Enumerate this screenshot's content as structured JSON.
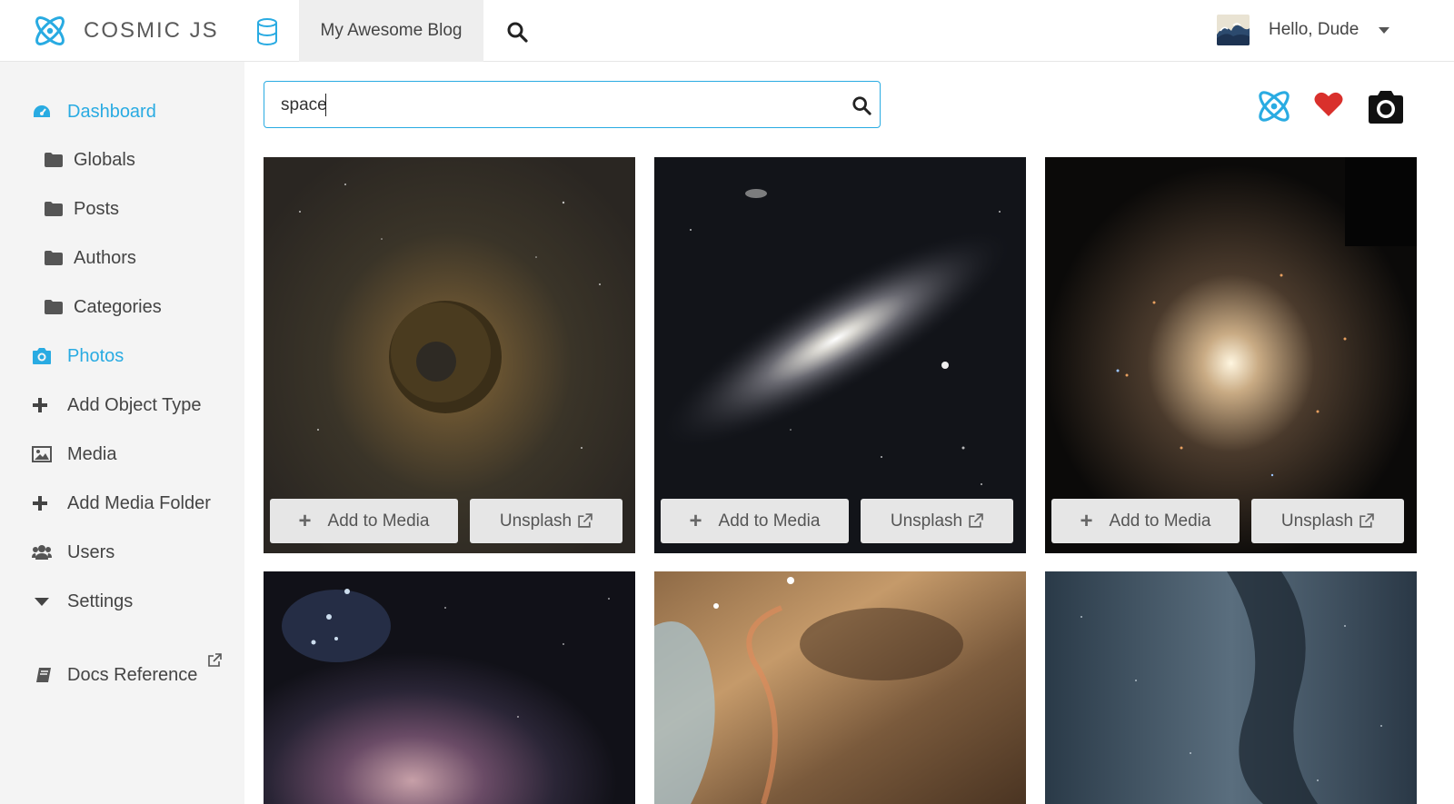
{
  "header": {
    "brand": "COSMIC JS",
    "bucket_title": "My Awesome Blog",
    "greeting": "Hello, Dude"
  },
  "sidebar": {
    "items": [
      {
        "label": "Dashboard",
        "icon": "dashboard-icon",
        "active": true
      },
      {
        "label": "Globals",
        "icon": "folder-icon"
      },
      {
        "label": "Posts",
        "icon": "folder-icon"
      },
      {
        "label": "Authors",
        "icon": "folder-icon"
      },
      {
        "label": "Categories",
        "icon": "folder-icon"
      },
      {
        "label": "Photos",
        "icon": "camera-icon",
        "active": true
      },
      {
        "label": "Add Object Type",
        "icon": "plus-icon"
      },
      {
        "label": "Media",
        "icon": "image-icon"
      },
      {
        "label": "Add Media Folder",
        "icon": "plus-icon"
      },
      {
        "label": "Users",
        "icon": "users-icon"
      },
      {
        "label": "Settings",
        "icon": "caret-down-icon"
      },
      {
        "label": "Docs Reference",
        "icon": "book-icon",
        "external": true
      }
    ]
  },
  "search": {
    "value": "space"
  },
  "photos": {
    "add_label": "Add to Media",
    "unsplash_label": "Unsplash",
    "items": [
      {
        "subject": "tiny planet under milky way"
      },
      {
        "subject": "andromeda galaxy"
      },
      {
        "subject": "globular star cluster"
      },
      {
        "subject": "orion nebula"
      },
      {
        "subject": "colorful nebula clouds"
      },
      {
        "subject": "milky way band"
      }
    ]
  },
  "colors": {
    "accent": "#29abe2",
    "heart": "#d9302c"
  }
}
